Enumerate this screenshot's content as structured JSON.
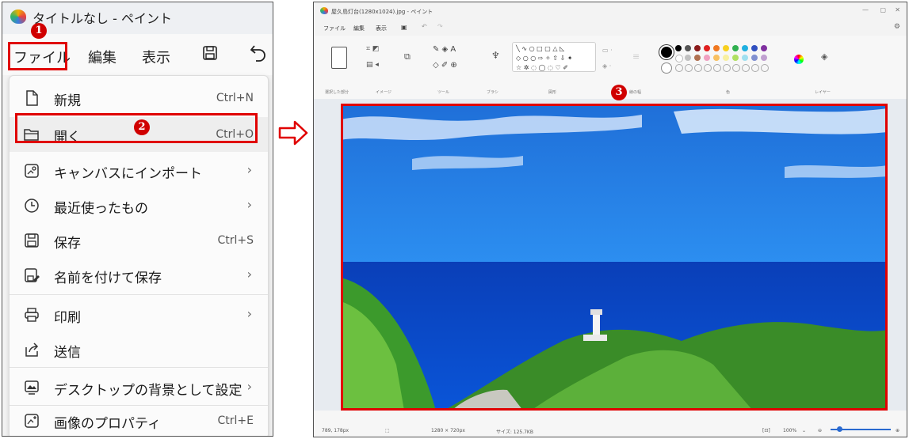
{
  "left_window": {
    "title": "タイトルなし - ペイント",
    "menubar": {
      "file": "ファイル",
      "edit": "編集",
      "view": "表示"
    },
    "menu_items": [
      {
        "label": "新規",
        "shortcut": "Ctrl+N",
        "icon": "new-file-icon"
      },
      {
        "label": "開く",
        "shortcut": "Ctrl+O",
        "icon": "folder-open-icon"
      },
      {
        "label": "キャンバスにインポート",
        "submenu": "›",
        "icon": "import-image-icon"
      },
      {
        "label": "最近使ったもの",
        "submenu": "›",
        "icon": "clock-icon"
      },
      {
        "label": "保存",
        "shortcut": "Ctrl+S",
        "icon": "save-icon"
      },
      {
        "label": "名前を付けて保存",
        "submenu": "›",
        "icon": "save-as-icon"
      },
      {
        "label": "印刷",
        "submenu": "›",
        "icon": "printer-icon"
      },
      {
        "label": "送信",
        "icon": "share-icon"
      },
      {
        "label": "デスクトップの背景として設定",
        "submenu": "›",
        "icon": "desktop-icon"
      },
      {
        "label": "画像のプロパティ",
        "shortcut": "Ctrl+E",
        "icon": "image-properties-icon"
      }
    ]
  },
  "badges": {
    "one": "1",
    "two": "2",
    "three": "3"
  },
  "right_window": {
    "title": "屋久島灯台(1280x1024).jpg - ペイント",
    "menubar": {
      "file": "ファイル",
      "edit": "編集",
      "view": "表示"
    },
    "ribbon_groups": [
      "選択した部分",
      "イメージ",
      "ツール",
      "ブラシ",
      "図形",
      "線の幅",
      "色",
      "レイヤー"
    ],
    "status": {
      "cursor": "789, 178px",
      "size": "1280 × 720px",
      "filesize": "サイズ: 125.7KB",
      "zoom": "100%"
    }
  },
  "colors": {
    "annotation_red": "#e00000",
    "badge_red": "#d00000"
  }
}
